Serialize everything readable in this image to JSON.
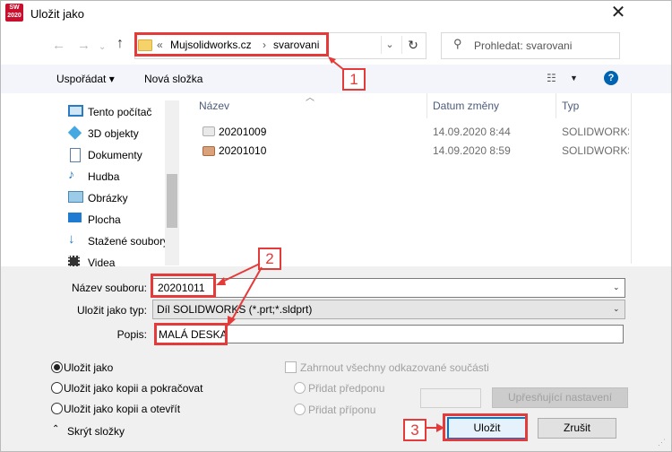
{
  "window": {
    "title": "Uložit jako",
    "logo_text": "SW 2020"
  },
  "nav": {
    "breadcrumb": [
      "Mujsolidworks.cz",
      "svarovani"
    ],
    "breadcrumb_prefix": "«",
    "search_placeholder": "Prohledat: svarovani"
  },
  "toolbar": {
    "organize": "Uspořádat ▾",
    "new_folder": "Nová složka"
  },
  "sidebar": {
    "items": [
      {
        "label": "Tento počítač",
        "icon": "computer-icon"
      },
      {
        "label": "3D objekty",
        "icon": "cube-icon"
      },
      {
        "label": "Dokumenty",
        "icon": "document-icon"
      },
      {
        "label": "Hudba",
        "icon": "music-icon"
      },
      {
        "label": "Obrázky",
        "icon": "picture-icon"
      },
      {
        "label": "Plocha",
        "icon": "desktop-icon"
      },
      {
        "label": "Stažené soubory",
        "icon": "download-icon"
      },
      {
        "label": "Videa",
        "icon": "video-icon"
      }
    ]
  },
  "files": {
    "columns": [
      "Název",
      "Datum změny",
      "Typ"
    ],
    "rows": [
      {
        "name": "20201009",
        "date": "14.09.2020 8:44",
        "type": "SOLIDWORKS Part Document"
      },
      {
        "name": "20201010",
        "date": "14.09.2020 8:59",
        "type": "SOLIDWORKS Part Document"
      }
    ]
  },
  "form": {
    "filename_label": "Název souboru:",
    "filename_value": "20201011",
    "savetype_label": "Uložit jako typ:",
    "savetype_value": "Díl SOLIDWORKS (*.prt;*.sldprt)",
    "desc_label": "Popis:",
    "desc_value": "MALÁ DESKA"
  },
  "options": {
    "save_as": "Uložit jako",
    "save_copy_continue": "Uložit jako kopii a pokračovat",
    "save_copy_open": "Uložit jako kopii a otevřít",
    "include_refs": "Zahrnout všechny odkazované součásti",
    "add_prefix": "Přidat předponu",
    "add_suffix": "Přidat příponu",
    "advanced": "Upřesňující nastavení",
    "hide_folders": "Skrýt složky"
  },
  "buttons": {
    "save": "Uložit",
    "cancel": "Zrušit"
  },
  "annotations": {
    "badge1": "1",
    "badge2": "2",
    "badge3": "3"
  },
  "colors": {
    "highlight": "#e53a3a",
    "accent": "#0078d7"
  }
}
